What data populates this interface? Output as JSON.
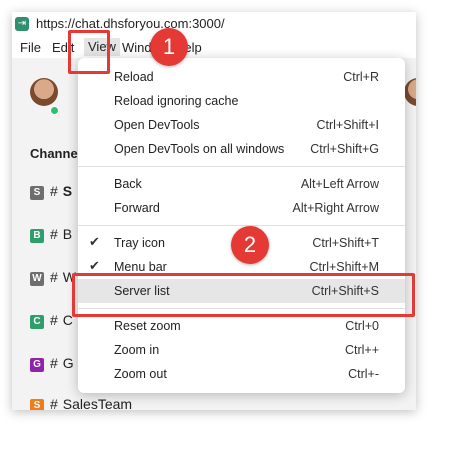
{
  "window": {
    "url": "https://chat.dhsforyou.com:3000/"
  },
  "menubar": {
    "file": "File",
    "edit": "Edit",
    "view": "View",
    "window": "Window",
    "help": "Help"
  },
  "sidebar": {
    "channels_heading": "Channels",
    "channels": [
      {
        "badge": "S",
        "name": "S",
        "color": "#6e6e6e"
      },
      {
        "badge": "B",
        "name": "B",
        "color": "#2e9e6b"
      },
      {
        "badge": "W",
        "name": "W",
        "color": "#6e6e6e"
      },
      {
        "badge": "C",
        "name": "C",
        "color": "#2e9e6b"
      },
      {
        "badge": "G",
        "name": "G",
        "color": "#8e24aa"
      },
      {
        "badge": "S",
        "name": "SalesTeam",
        "color": "#ef7d1a"
      }
    ]
  },
  "view_menu": {
    "items": [
      {
        "label": "Reload",
        "shortcut": "Ctrl+R"
      },
      {
        "label": "Reload ignoring cache",
        "shortcut": ""
      },
      {
        "label": "Open DevTools",
        "shortcut": "Ctrl+Shift+I"
      },
      {
        "label": "Open DevTools on all windows",
        "shortcut": "Ctrl+Shift+G"
      },
      {
        "label": "Back",
        "shortcut": "Alt+Left Arrow"
      },
      {
        "label": "Forward",
        "shortcut": "Alt+Right Arrow"
      },
      {
        "label": "Tray icon",
        "shortcut": "Ctrl+Shift+T",
        "checked": true
      },
      {
        "label": "Menu bar",
        "shortcut": "Ctrl+Shift+M",
        "checked": true
      },
      {
        "label": "Server list",
        "shortcut": "Ctrl+Shift+S",
        "highlighted": true
      },
      {
        "label": "Reset zoom",
        "shortcut": "Ctrl+0"
      },
      {
        "label": "Zoom in",
        "shortcut": "Ctrl++"
      },
      {
        "label": "Zoom out",
        "shortcut": "Ctrl+-"
      }
    ]
  },
  "callouts": {
    "one": "1",
    "two": "2",
    "color": "#e53935"
  },
  "icons": {
    "app": "app-logo-icon",
    "check": "checkmark-icon",
    "hash": "hash-icon"
  }
}
